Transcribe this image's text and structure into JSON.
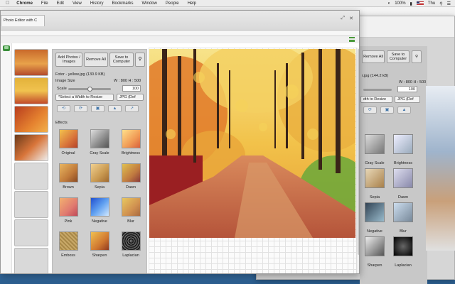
{
  "menubar": {
    "items": [
      "Chrome",
      "File",
      "Edit",
      "View",
      "History",
      "Bookmarks",
      "Window",
      "People",
      "Help"
    ],
    "battery": "100%",
    "time": "Thu"
  },
  "tab": {
    "title": "Photo Editor with C"
  },
  "panel": {
    "add_photos": "Add Photos / Images",
    "remove_all": "Remove All",
    "save_to_computer": "Save to Computer",
    "file_name": "Fotor - yellow.jpg (130.9 KB)",
    "image_size_label": "Image Size",
    "image_size_value": "W : 800 H : 500",
    "scale_label": "Scale",
    "scale_value": "100",
    "scale_fraction": 0.5,
    "width_select": "*Select a Width to Resize",
    "format_select": "JPG (Def",
    "effects_label": "Effects",
    "effects": [
      "Original",
      "Gray Scale",
      "Brightness",
      "Brown",
      "Sepia",
      "Dawn",
      "Pink",
      "Negative",
      "Blur",
      "Emboss",
      "Sharpen",
      "Laplacian"
    ]
  },
  "bgwin": {
    "remove_all": "Remove All",
    "save_to_computer": "Save to Computer",
    "file_size": "r.jpg (144.2 kB)",
    "image_size_value": "W : 800 H : 500",
    "scale_value": "100",
    "width_select": "dth to Resize",
    "format_select": "JPG (Def",
    "effects": [
      "Gray Scale",
      "Brightness",
      "Sepia",
      "Dawn",
      "Negative",
      "Blur",
      "Sharpen",
      "Laplacian"
    ]
  },
  "colors": {
    "accent_green": "#4a9a3a",
    "panel_bg": "#cfcfcf"
  }
}
